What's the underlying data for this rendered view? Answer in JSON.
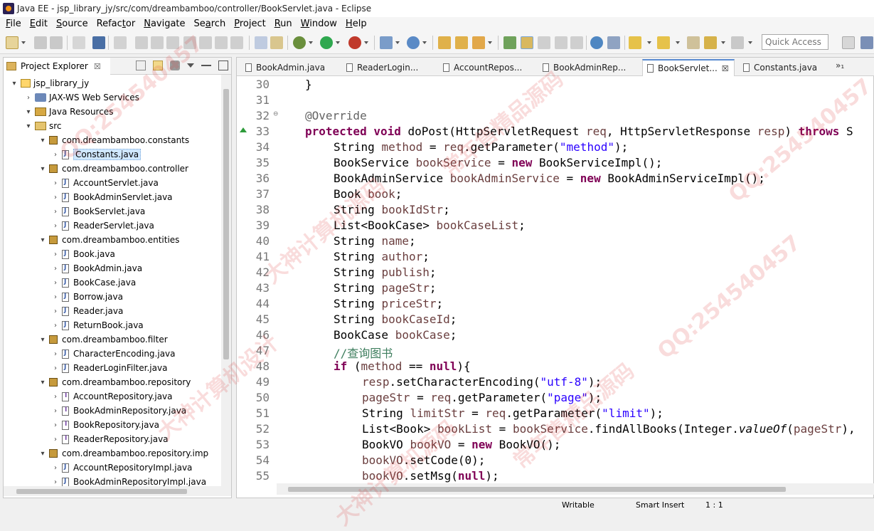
{
  "window": {
    "title": "Java EE - jsp_library_jy/src/com/dreambamboo/controller/BookServlet.java - Eclipse"
  },
  "menu": {
    "items": [
      {
        "pre": "",
        "u": "F",
        "post": "ile"
      },
      {
        "pre": "",
        "u": "E",
        "post": "dit"
      },
      {
        "pre": "",
        "u": "S",
        "post": "ource"
      },
      {
        "pre": "Refac",
        "u": "t",
        "post": "or"
      },
      {
        "pre": "",
        "u": "N",
        "post": "avigate"
      },
      {
        "pre": "Se",
        "u": "a",
        "post": "rch"
      },
      {
        "pre": "",
        "u": "P",
        "post": "roject"
      },
      {
        "pre": "",
        "u": "R",
        "post": "un"
      },
      {
        "pre": "",
        "u": "W",
        "post": "indow"
      },
      {
        "pre": "",
        "u": "H",
        "post": "elp"
      }
    ]
  },
  "toolbar": {
    "quick_access": "Quick Access"
  },
  "project_explorer": {
    "tab_label": "Project Explorer",
    "close": "☒",
    "tree": [
      {
        "label": "jsp_library_jy",
        "depth": 0,
        "twisty": "▾",
        "icon": "project"
      },
      {
        "label": "JAX-WS Web Services",
        "depth": 1,
        "twisty": "›",
        "icon": "ws"
      },
      {
        "label": "Java Resources",
        "depth": 1,
        "twisty": "▾",
        "icon": "jres"
      },
      {
        "label": "src",
        "depth": 2,
        "twisty": "▾",
        "icon": "src"
      },
      {
        "label": "com.dreambamboo.constants",
        "depth": 3,
        "twisty": "▾",
        "icon": "pkg"
      },
      {
        "label": "Constants.java",
        "depth": 4,
        "twisty": "›",
        "icon": "java",
        "selected": true
      },
      {
        "label": "com.dreambamboo.controller",
        "depth": 3,
        "twisty": "▾",
        "icon": "pkg"
      },
      {
        "label": "AccountServlet.java",
        "depth": 4,
        "twisty": "›",
        "icon": "java"
      },
      {
        "label": "BookAdminServlet.java",
        "depth": 4,
        "twisty": "›",
        "icon": "java"
      },
      {
        "label": "BookServlet.java",
        "depth": 4,
        "twisty": "›",
        "icon": "java"
      },
      {
        "label": "ReaderServlet.java",
        "depth": 4,
        "twisty": "›",
        "icon": "java"
      },
      {
        "label": "com.dreambamboo.entities",
        "depth": 3,
        "twisty": "▾",
        "icon": "pkg"
      },
      {
        "label": "Book.java",
        "depth": 4,
        "twisty": "›",
        "icon": "java"
      },
      {
        "label": "BookAdmin.java",
        "depth": 4,
        "twisty": "›",
        "icon": "java"
      },
      {
        "label": "BookCase.java",
        "depth": 4,
        "twisty": "›",
        "icon": "java"
      },
      {
        "label": "Borrow.java",
        "depth": 4,
        "twisty": "›",
        "icon": "java"
      },
      {
        "label": "Reader.java",
        "depth": 4,
        "twisty": "›",
        "icon": "java"
      },
      {
        "label": "ReturnBook.java",
        "depth": 4,
        "twisty": "›",
        "icon": "java"
      },
      {
        "label": "com.dreambamboo.filter",
        "depth": 3,
        "twisty": "▾",
        "icon": "pkg"
      },
      {
        "label": "CharacterEncoding.java",
        "depth": 4,
        "twisty": "›",
        "icon": "java"
      },
      {
        "label": "ReaderLoginFilter.java",
        "depth": 4,
        "twisty": "›",
        "icon": "java"
      },
      {
        "label": "com.dreambamboo.repository",
        "depth": 3,
        "twisty": "▾",
        "icon": "pkg"
      },
      {
        "label": "AccountRepository.java",
        "depth": 4,
        "twisty": "›",
        "icon": "iface"
      },
      {
        "label": "BookAdminRepository.java",
        "depth": 4,
        "twisty": "›",
        "icon": "iface"
      },
      {
        "label": "BookRepository.java",
        "depth": 4,
        "twisty": "›",
        "icon": "iface"
      },
      {
        "label": "ReaderRepository.java",
        "depth": 4,
        "twisty": "›",
        "icon": "iface"
      },
      {
        "label": "com.dreambamboo.repository.imp",
        "depth": 3,
        "twisty": "▾",
        "icon": "pkg"
      },
      {
        "label": "AccountRepositoryImpl.java",
        "depth": 4,
        "twisty": "›",
        "icon": "java"
      },
      {
        "label": "BookAdminRepositoryImpl.java",
        "depth": 4,
        "twisty": "›",
        "icon": "java"
      }
    ]
  },
  "editor": {
    "tabs": [
      {
        "label": "BookAdmin.java",
        "active": false
      },
      {
        "label": "ReaderLogin...",
        "active": false
      },
      {
        "label": "AccountRepos...",
        "active": false
      },
      {
        "label": "BookAdminRep...",
        "active": false
      },
      {
        "label": "BookServlet...",
        "active": true
      },
      {
        "label": "Constants.java",
        "active": false
      }
    ],
    "overflow": "»₁",
    "lines": [
      {
        "n": "30",
        "indent": 1,
        "tokens": [
          [
            "p",
            "}"
          ]
        ]
      },
      {
        "n": "31",
        "indent": 0,
        "tokens": []
      },
      {
        "n": "32",
        "fold": "⊖",
        "indent": 1,
        "tokens": [
          [
            "ann",
            "@Override"
          ]
        ]
      },
      {
        "n": "33",
        "mark": true,
        "indent": 1,
        "tokens": [
          [
            "kw",
            "protected"
          ],
          [
            "p",
            " "
          ],
          [
            "kw",
            "void"
          ],
          [
            "p",
            " doPost(HttpServletRequest "
          ],
          [
            "var",
            "req"
          ],
          [
            "p",
            ", HttpServletResponse "
          ],
          [
            "var",
            "resp"
          ],
          [
            "p",
            ") "
          ],
          [
            "kw",
            "throws"
          ],
          [
            "p",
            " S"
          ]
        ]
      },
      {
        "n": "34",
        "indent": 2,
        "tokens": [
          [
            "p",
            "String "
          ],
          [
            "var",
            "method"
          ],
          [
            "p",
            " = "
          ],
          [
            "var",
            "req"
          ],
          [
            "p",
            ".getParameter("
          ],
          [
            "str",
            "\"method\""
          ],
          [
            "p",
            ");"
          ]
        ]
      },
      {
        "n": "35",
        "indent": 2,
        "tokens": [
          [
            "p",
            "BookService "
          ],
          [
            "var",
            "bookService"
          ],
          [
            "p",
            " = "
          ],
          [
            "kw",
            "new"
          ],
          [
            "p",
            " BookServiceImpl();"
          ]
        ]
      },
      {
        "n": "36",
        "indent": 2,
        "tokens": [
          [
            "p",
            "BookAdminService "
          ],
          [
            "var",
            "bookAdminService"
          ],
          [
            "p",
            " = "
          ],
          [
            "kw",
            "new"
          ],
          [
            "p",
            " BookAdminServiceImpl();"
          ]
        ]
      },
      {
        "n": "37",
        "indent": 2,
        "tokens": [
          [
            "p",
            "Book "
          ],
          [
            "var",
            "book"
          ],
          [
            "p",
            ";"
          ]
        ]
      },
      {
        "n": "38",
        "indent": 2,
        "tokens": [
          [
            "p",
            "String "
          ],
          [
            "var",
            "bookIdStr"
          ],
          [
            "p",
            ";"
          ]
        ]
      },
      {
        "n": "39",
        "indent": 2,
        "tokens": [
          [
            "p",
            "List<BookCase> "
          ],
          [
            "var",
            "bookCaseList"
          ],
          [
            "p",
            ";"
          ]
        ]
      },
      {
        "n": "40",
        "indent": 2,
        "tokens": [
          [
            "p",
            "String "
          ],
          [
            "var",
            "name"
          ],
          [
            "p",
            ";"
          ]
        ]
      },
      {
        "n": "41",
        "indent": 2,
        "tokens": [
          [
            "p",
            "String "
          ],
          [
            "var",
            "author"
          ],
          [
            "p",
            ";"
          ]
        ]
      },
      {
        "n": "42",
        "indent": 2,
        "tokens": [
          [
            "p",
            "String "
          ],
          [
            "var",
            "publish"
          ],
          [
            "p",
            ";"
          ]
        ]
      },
      {
        "n": "43",
        "indent": 2,
        "tokens": [
          [
            "p",
            "String "
          ],
          [
            "var",
            "pageStr"
          ],
          [
            "p",
            ";"
          ]
        ]
      },
      {
        "n": "44",
        "indent": 2,
        "tokens": [
          [
            "p",
            "String "
          ],
          [
            "var",
            "priceStr"
          ],
          [
            "p",
            ";"
          ]
        ]
      },
      {
        "n": "45",
        "indent": 2,
        "tokens": [
          [
            "p",
            "String "
          ],
          [
            "var",
            "bookCaseId"
          ],
          [
            "p",
            ";"
          ]
        ]
      },
      {
        "n": "46",
        "indent": 2,
        "tokens": [
          [
            "p",
            "BookCase "
          ],
          [
            "var",
            "bookCase"
          ],
          [
            "p",
            ";"
          ]
        ]
      },
      {
        "n": "47",
        "indent": 2,
        "tokens": [
          [
            "cmt",
            "//查询图书"
          ]
        ]
      },
      {
        "n": "48",
        "indent": 2,
        "tokens": [
          [
            "kw",
            "if"
          ],
          [
            "p",
            " ("
          ],
          [
            "var",
            "method"
          ],
          [
            "p",
            " == "
          ],
          [
            "kw",
            "null"
          ],
          [
            "p",
            "){"
          ]
        ]
      },
      {
        "n": "49",
        "indent": 3,
        "tokens": [
          [
            "var",
            "resp"
          ],
          [
            "p",
            ".setCharacterEncoding("
          ],
          [
            "str",
            "\"utf-8\""
          ],
          [
            "p",
            ");"
          ]
        ]
      },
      {
        "n": "50",
        "indent": 3,
        "tokens": [
          [
            "var",
            "pageStr"
          ],
          [
            "p",
            " = "
          ],
          [
            "var",
            "req"
          ],
          [
            "p",
            ".getParameter("
          ],
          [
            "str",
            "\"page\""
          ],
          [
            "p",
            ");"
          ]
        ]
      },
      {
        "n": "51",
        "indent": 3,
        "tokens": [
          [
            "p",
            "String "
          ],
          [
            "var",
            "limitStr"
          ],
          [
            "p",
            " = "
          ],
          [
            "var",
            "req"
          ],
          [
            "p",
            ".getParameter("
          ],
          [
            "str",
            "\"limit\""
          ],
          [
            "p",
            ");"
          ]
        ]
      },
      {
        "n": "52",
        "indent": 3,
        "tokens": [
          [
            "p",
            "List<Book> "
          ],
          [
            "var",
            "bookList"
          ],
          [
            "p",
            " = "
          ],
          [
            "var",
            "bookService"
          ],
          [
            "p",
            ".findAllBooks(Integer."
          ],
          [
            "ital",
            "valueOf"
          ],
          [
            "p",
            "("
          ],
          [
            "var",
            "pageStr"
          ],
          [
            "p",
            "),"
          ]
        ]
      },
      {
        "n": "53",
        "indent": 3,
        "tokens": [
          [
            "p",
            "BookVO "
          ],
          [
            "var",
            "bookVO"
          ],
          [
            "p",
            " = "
          ],
          [
            "kw",
            "new"
          ],
          [
            "p",
            " BookVO();"
          ]
        ]
      },
      {
        "n": "54",
        "indent": 3,
        "tokens": [
          [
            "var",
            "bookVO"
          ],
          [
            "p",
            ".setCode(0);"
          ]
        ]
      },
      {
        "n": "55",
        "indent": 3,
        "tokens": [
          [
            "var",
            "bookVO"
          ],
          [
            "p",
            ".setMsg("
          ],
          [
            "kw",
            "null"
          ],
          [
            "p",
            ");"
          ]
        ]
      }
    ]
  },
  "status": {
    "writable": "Writable",
    "insert": "Smart Insert",
    "position": "1 : 1"
  },
  "watermarks": [
    "QQ:254540457",
    "大神计算机源码",
    "常年售精品源码",
    "QQ:254540457",
    "大神计算机设计",
    "常年售精品源码",
    "QQ:254540457",
    "大神计算机源码"
  ]
}
